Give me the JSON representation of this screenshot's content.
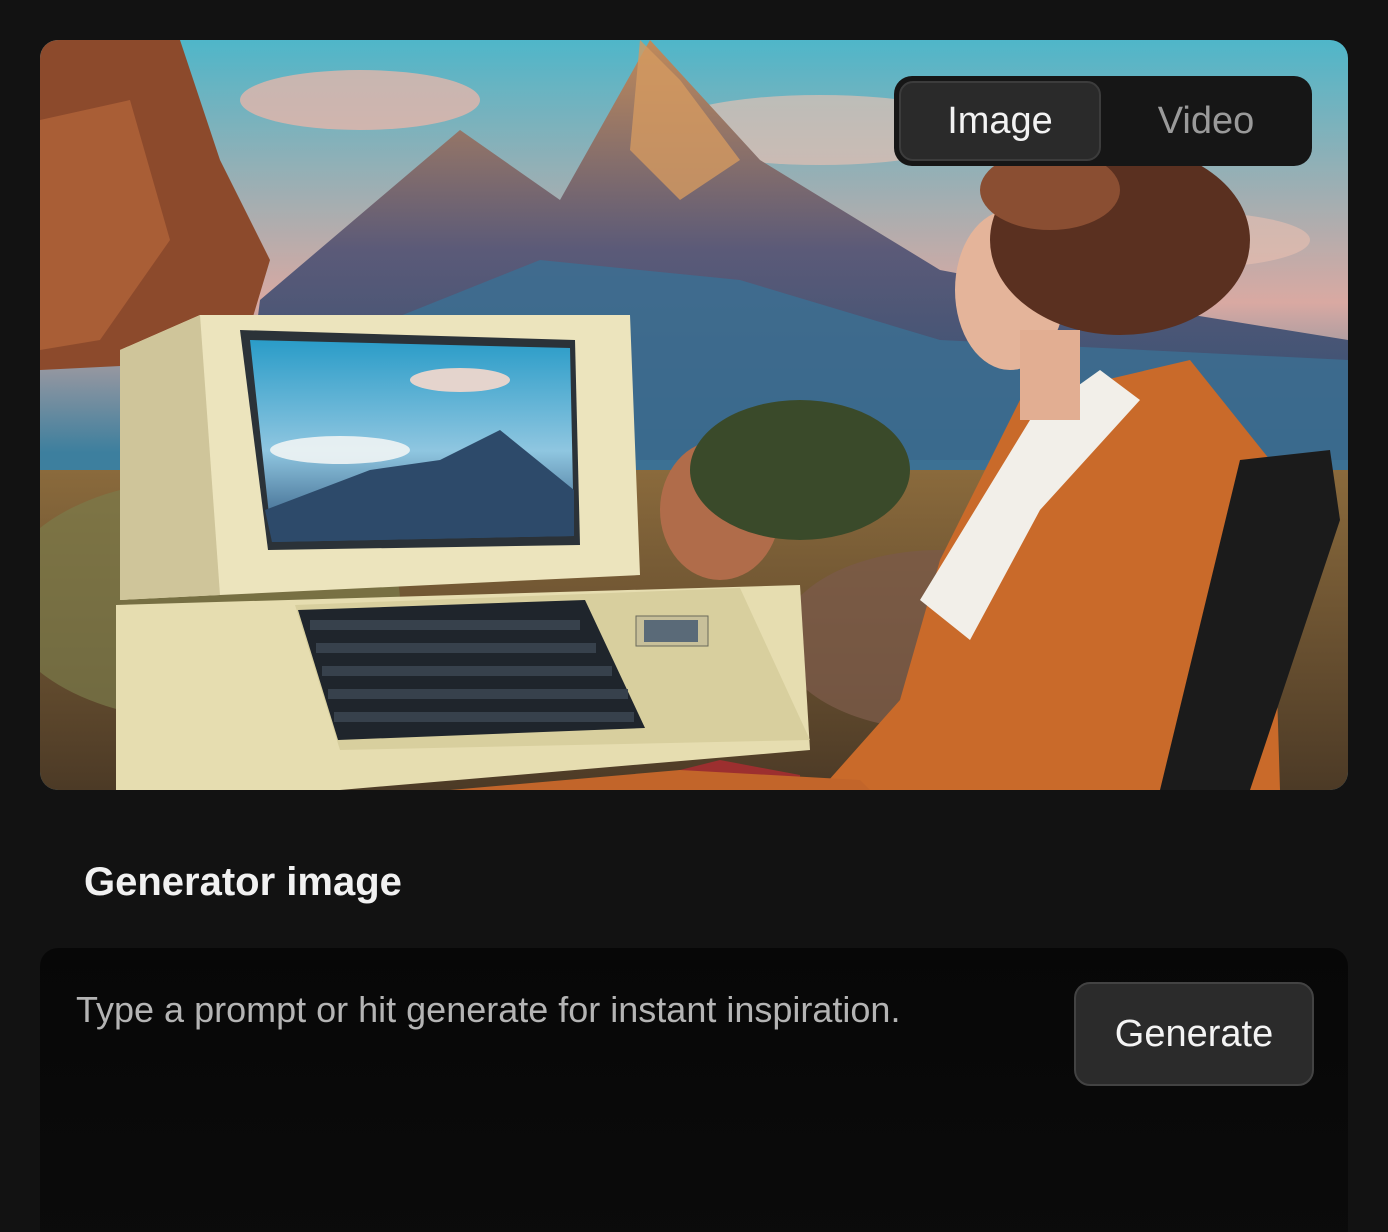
{
  "hero": {
    "image_alt": "Retro illustration of a woman in an orange blazer at a beige vintage computer in a mountain landscape"
  },
  "mode_toggle": {
    "options": [
      {
        "label": "Image",
        "active": true
      },
      {
        "label": "Video",
        "active": false
      }
    ]
  },
  "generator": {
    "title": "Generator image",
    "prompt_placeholder": "Type a prompt or hit generate for instant inspiration.",
    "prompt_value": "",
    "generate_label": "Generate"
  },
  "colors": {
    "background": "#121212",
    "panel": "#080808",
    "button": "#2b2b2b",
    "text": "#f1f1f1"
  }
}
